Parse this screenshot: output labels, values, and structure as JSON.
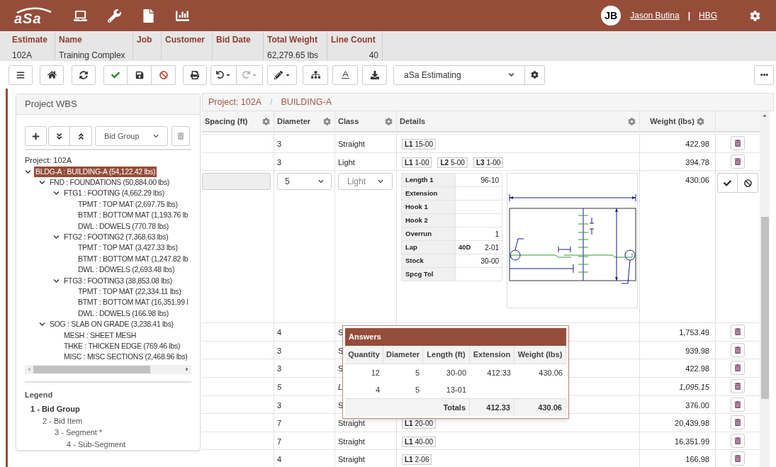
{
  "header": {
    "logo": "aSa",
    "user": {
      "initials": "JB",
      "name": "Jason Butina",
      "separator": "|",
      "org": "HBG"
    }
  },
  "estimate_fields": [
    {
      "label": "Estimate",
      "value": "102A"
    },
    {
      "label": "Name",
      "value": "Training Complex"
    },
    {
      "label": "Job"
    },
    {
      "label": "Customer"
    },
    {
      "label": "Bid Date"
    },
    {
      "label": "Total Weight",
      "value": "62,279.65 lbs"
    },
    {
      "label": "Line Count",
      "value": "40"
    }
  ],
  "toolbar": {
    "history": [
      {
        "kind": "undo",
        "disabled": false
      },
      {
        "kind": "redo",
        "disabled": true
      }
    ],
    "module_select": {
      "value": "aSa Estimating"
    }
  },
  "wbs": {
    "title": "Project WBS",
    "level_select": {
      "value": "Bid Group"
    },
    "project_label": "Project: 102A",
    "tree": [
      {
        "label": "BLDG-A : BUILDING-A (54,122.42 lbs)",
        "selected": true,
        "expanded": true,
        "children": [
          {
            "label": "FND : FOUNDATIONS (50,884.00 lbs)",
            "selected": false,
            "expanded": true,
            "children": [
              {
                "label": "FTG1 : FOOTING (4,662.29 lbs)",
                "selected": false,
                "expanded": true,
                "children": [
                  {
                    "label": "TPMT : TOP MAT (2,697.75 lbs)",
                    "selected": false
                  },
                  {
                    "label": "BTMT : BOTTOM MAT (1,193.76 lb",
                    "selected": false
                  },
                  {
                    "label": "DWL : DOWELS (770.78 lbs)",
                    "selected": false
                  }
                ]
              },
              {
                "label": "FTG2 : FOOTING2 (7,368.63 lbs)",
                "selected": false,
                "expanded": true,
                "children": [
                  {
                    "label": "TPMT : TOP MAT (3,427.33 lbs)",
                    "selected": false
                  },
                  {
                    "label": "BTMT : BOTTOM MAT (1,247.82 lb",
                    "selected": false
                  },
                  {
                    "label": "DWL : DOWELS (2,693.48 lbs)",
                    "selected": false
                  }
                ]
              },
              {
                "label": "FTG3 : FOOTING3 (38,853.08 lbs)",
                "selected": false,
                "expanded": true,
                "children": [
                  {
                    "label": "TPMT : TOP MAT (22,334.11 lbs)",
                    "selected": false
                  },
                  {
                    "label": "BTMT : BOTTOM MAT (16,351.99 l",
                    "selected": false
                  },
                  {
                    "label": "DWL : DOWELS (166.98 lbs)",
                    "selected": false
                  }
                ]
              }
            ]
          },
          {
            "label": "SOG : SLAB ON GRADE (3,238.41 lbs)",
            "selected": false,
            "expanded": true,
            "children": [
              {
                "label": "MESH : SHEET MESH",
                "selected": false
              },
              {
                "label": "THKE : THICKEN EDGE (769.46 lbs)",
                "selected": false
              },
              {
                "label": "MISC : MISC SECTIONS (2,468.96 lbs)",
                "selected": false
              }
            ]
          }
        ]
      }
    ],
    "legend": {
      "title": "Legend",
      "items": [
        {
          "label": "1 - Bid Group",
          "children": [
            {
              "label": "2 - Bid Item",
              "children": [
                {
                  "label": "3 - Segment *",
                  "children": [
                    {
                      "label": "4 - Sub-Segment"
                    }
                  ]
                }
              ]
            }
          ]
        }
      ]
    }
  },
  "breadcrumb": {
    "items": [
      "Project: 102A",
      "BUILDING-A"
    ],
    "separator": "/"
  },
  "table": {
    "columns": [
      {
        "label": "Spacing (ft)",
        "settings": true
      },
      {
        "label": "Diameter",
        "settings": true
      },
      {
        "label": "Class",
        "settings": true
      },
      {
        "label": "Details",
        "settings": true
      },
      {
        "label": "Weight (lbs)",
        "settings": true
      }
    ],
    "rows": [
      {
        "kind": "line",
        "diameter": "3",
        "class": "Straight",
        "details": [
          "**L1** 15-00"
        ],
        "weight": "422.98",
        "italic": false
      },
      {
        "kind": "line",
        "diameter": "3",
        "class": "Light",
        "details": [
          "**L1** 1-00",
          "**L2** 5-00",
          "**L3** 1-00"
        ],
        "weight": "394.78",
        "italic": false
      },
      {
        "kind": "edit",
        "spacing_field": {
          "disabled": true
        },
        "diameter": "5",
        "class": "Light",
        "weight": "430.06",
        "fields": [
          {
            "label": "Length 1",
            "value": "96-10"
          },
          {
            "label": "Extension"
          },
          {
            "label": "Hook 1"
          },
          {
            "label": "Hook 2"
          },
          {
            "label": "Overrun",
            "value": "1"
          },
          {
            "label": "Lap",
            "factor": "40D",
            "value": "2-01"
          },
          {
            "label": "Stock",
            "value": "30-00"
          },
          {
            "label": "Spcg Tol"
          }
        ]
      },
      {
        "kind": "line",
        "diameter": "4",
        "class": "S",
        "weight": "1,753.49",
        "italic": false
      },
      {
        "kind": "line",
        "diameter": "3",
        "class": "S",
        "weight": "939.98",
        "italic": false
      },
      {
        "kind": "line",
        "diameter": "3",
        "class": "S",
        "weight": "422.98",
        "italic": false
      },
      {
        "kind": "line",
        "diameter": "5",
        "class": "L",
        "weight": "1,095.15",
        "italic": true
      },
      {
        "kind": "line",
        "diameter": "3",
        "class": "S",
        "weight": "376.00",
        "italic": false
      },
      {
        "kind": "line",
        "diameter": "7",
        "class": "Straight",
        "details": [
          "**L1** 20-00"
        ],
        "weight": "20,439.98",
        "italic": false
      },
      {
        "kind": "line",
        "diameter": "7",
        "class": "Straight",
        "details": [
          "**L1** 40-00"
        ],
        "weight": "16,351.99",
        "italic": false
      },
      {
        "kind": "line",
        "diameter": "4",
        "class": "Straight",
        "details": [
          "**L1** 2-06"
        ],
        "weight": "166.98",
        "italic": false
      }
    ]
  },
  "answers_popup": {
    "title": "Answers",
    "columns": [
      "Quantity",
      "Diameter",
      "Length (ft)",
      "Extension",
      "Weight (lbs)"
    ],
    "rows": [
      [
        "12",
        "5",
        "30-00",
        "412.33",
        "430.06"
      ],
      [
        "4",
        "5",
        "13-01"
      ]
    ],
    "totals": {
      "label": "Totals",
      "values": [
        "412.33",
        "430.06"
      ]
    }
  }
}
